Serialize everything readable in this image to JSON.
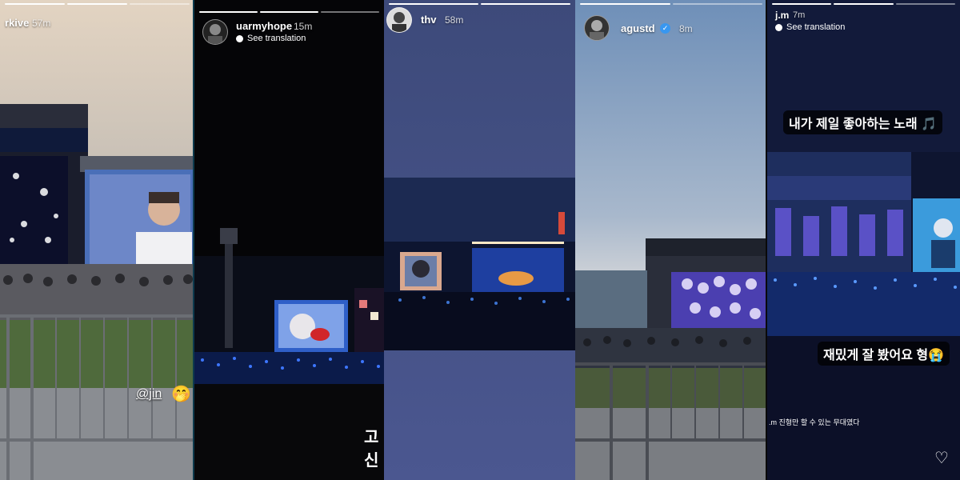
{
  "stories": [
    {
      "username": "rkive",
      "time": "57m",
      "mention": "@jin",
      "emoji": "🤭"
    },
    {
      "username": "uarmyhope",
      "time": "15m",
      "translation": "See translation",
      "caption": "고신"
    },
    {
      "username": "thv",
      "time": "58m"
    },
    {
      "username": "agustd",
      "time": "8m",
      "verified_icon": "verified-badge-icon"
    },
    {
      "username": "j.m",
      "time": "7m",
      "translation": "See translation",
      "sticker_top": "내가 제일 좋아하는 노래 🎵",
      "sticker_bottom": "재밌게 잘 봤어요 형😭",
      "small_caption": ".m 진형만 할 수 있는 무대였다",
      "like_icon": "heart-icon"
    }
  ],
  "colors": {
    "verified": "#3897f0",
    "divider": "#0d3a4d"
  }
}
